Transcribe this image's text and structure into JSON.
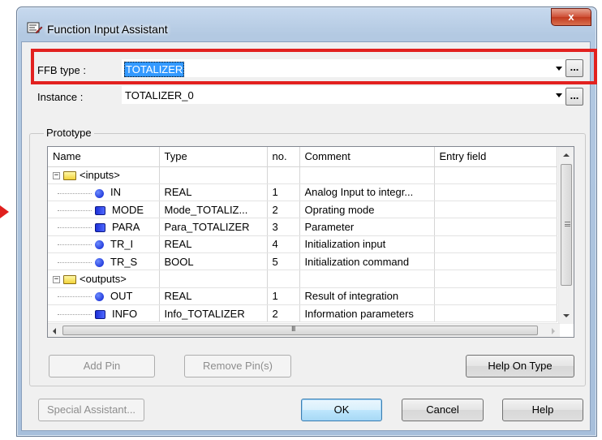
{
  "window": {
    "title": "Function Input Assistant",
    "close_label": "x"
  },
  "ffb_type": {
    "label": "FFB type :",
    "value": "TOTALIZER",
    "browse_label": "..."
  },
  "instance": {
    "label": "Instance :",
    "value": "TOTALIZER_0",
    "browse_label": "..."
  },
  "prototype": {
    "group_title": "Prototype",
    "columns": [
      "Name",
      "Type",
      "no.",
      "Comment",
      "Entry field"
    ],
    "rows": [
      {
        "kind": "group",
        "expander": "−",
        "name": "<inputs>"
      },
      {
        "kind": "pin",
        "icon": "circle",
        "name": "IN",
        "type": "REAL",
        "no": "1",
        "comment": "Analog Input to integr...",
        "entry": ""
      },
      {
        "kind": "pin",
        "icon": "book",
        "name": "MODE",
        "type": "Mode_TOTALIZ...",
        "no": "2",
        "comment": "Oprating mode",
        "entry": ""
      },
      {
        "kind": "pin",
        "icon": "book",
        "name": "PARA",
        "type": "Para_TOTALIZER",
        "no": "3",
        "comment": "Parameter",
        "entry": ""
      },
      {
        "kind": "pin",
        "icon": "circle",
        "name": "TR_I",
        "type": "REAL",
        "no": "4",
        "comment": "Initialization input",
        "entry": ""
      },
      {
        "kind": "pin",
        "icon": "circle",
        "name": "TR_S",
        "type": "BOOL",
        "no": "5",
        "comment": "Initialization command",
        "entry": ""
      },
      {
        "kind": "group",
        "expander": "−",
        "name": "<outputs>"
      },
      {
        "kind": "pin",
        "icon": "circle",
        "name": "OUT",
        "type": "REAL",
        "no": "1",
        "comment": "Result of integration",
        "entry": ""
      },
      {
        "kind": "pin",
        "icon": "book",
        "name": "INFO",
        "type": "Info_TOTALIZER",
        "no": "2",
        "comment": "Information parameters",
        "entry": ""
      }
    ],
    "scroll_grip": "III"
  },
  "buttons": {
    "add_pin": "Add Pin",
    "remove_pin": "Remove Pin(s)",
    "help_on_type": "Help On Type",
    "special_assistant": "Special Assistant...",
    "ok": "OK",
    "cancel": "Cancel",
    "help": "Help"
  },
  "colors": {
    "highlight": "#e2211f",
    "selection": "#3399ff"
  }
}
